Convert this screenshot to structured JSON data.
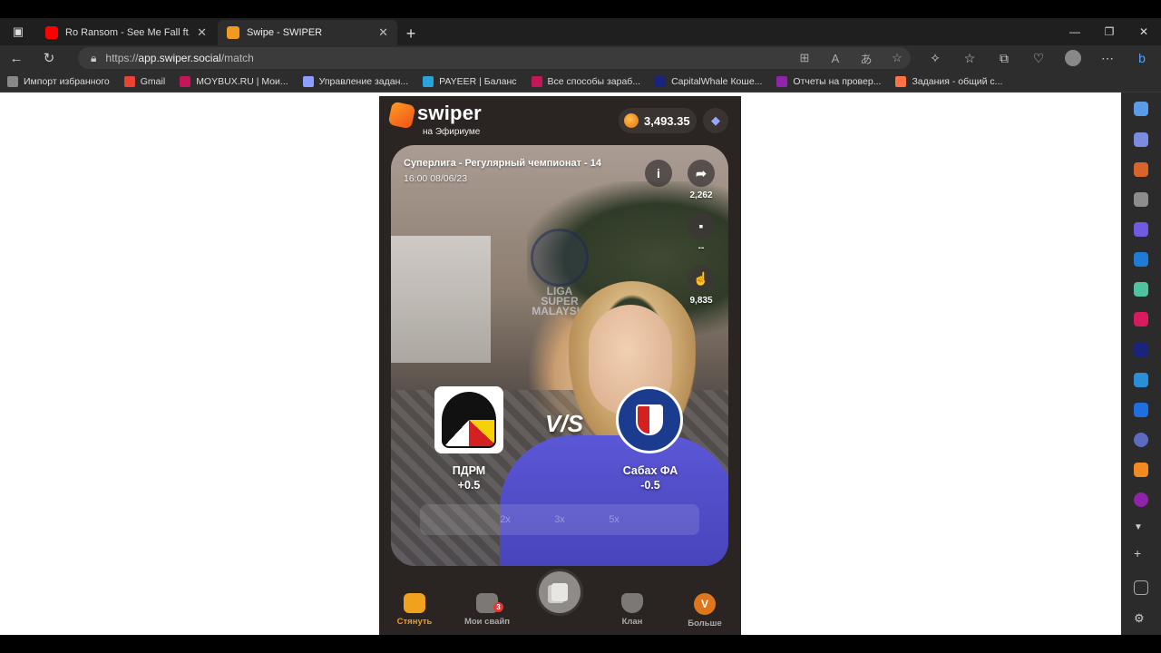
{
  "browser": {
    "tabs": [
      {
        "title": "Ro Ransom - See Me Fall ft. Kensi",
        "active": false,
        "favicon": "youtube-icon",
        "color": "#ff0000"
      },
      {
        "title": "Swipe - SWIPER",
        "active": true,
        "favicon": "swiper-icon",
        "color": "#f29a1f"
      }
    ],
    "url_prefix": "https://",
    "url_host": "app.swiper.social",
    "url_path": "/match",
    "bookmarks": [
      {
        "label": "Импорт избранного",
        "icon": "import-icon",
        "color": "#888888"
      },
      {
        "label": "Gmail",
        "icon": "gmail-icon",
        "color": "#ea4335"
      },
      {
        "label": "MOYBUX.RU | Мои...",
        "icon": "moybux-icon",
        "color": "#c2185b"
      },
      {
        "label": "Управление задан...",
        "icon": "v-icon",
        "color": "#8c9eff"
      },
      {
        "label": "PAYEER | Баланс",
        "icon": "payeer-icon",
        "color": "#29a3d9"
      },
      {
        "label": "Все способы зараб...",
        "icon": "earn-icon",
        "color": "#c2185b"
      },
      {
        "label": "CapitalWhale Коше...",
        "icon": "capitalwhale-icon",
        "color": "#1a237e"
      },
      {
        "label": "Отчеты на провер...",
        "icon": "diamond-icon",
        "color": "#8e24aa"
      },
      {
        "label": "Задания - общий с...",
        "icon": "s-icon",
        "color": "#ff7043"
      }
    ]
  },
  "app": {
    "logo": "swiper",
    "network": "на Эфириуме",
    "balance": "3,493.35",
    "card": {
      "league": "Суперлига - Регулярный чемпионат - 14",
      "datetime": "16:00 08/06/23",
      "share_count": "2,262",
      "comment_count": "--",
      "swipe_count": "9,835",
      "vs": "V/S",
      "watermark_line1": "LIGA SUPER",
      "watermark_line2": "MALAYSIA",
      "home": {
        "name": "ПДРМ",
        "line": "+0.5"
      },
      "away": {
        "name": "Сабах ФА",
        "line": "-0.5"
      },
      "multipliers": [
        "2x",
        "3x",
        "5x"
      ]
    },
    "nav": [
      {
        "label": "Стянуть",
        "active": true
      },
      {
        "label": "Мои свайп",
        "badge": "3",
        "active": false
      },
      {
        "label": "Клан",
        "active": false
      },
      {
        "label": "Больше",
        "avatar_letter": "V",
        "active": false
      }
    ]
  }
}
